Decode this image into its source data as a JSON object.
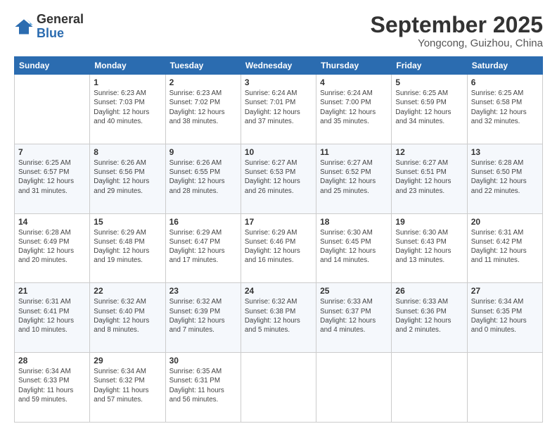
{
  "logo": {
    "general": "General",
    "blue": "Blue"
  },
  "header": {
    "month": "September 2025",
    "location": "Yongcong, Guizhou, China"
  },
  "days_of_week": [
    "Sunday",
    "Monday",
    "Tuesday",
    "Wednesday",
    "Thursday",
    "Friday",
    "Saturday"
  ],
  "weeks": [
    [
      {
        "day": "",
        "info": ""
      },
      {
        "day": "1",
        "info": "Sunrise: 6:23 AM\nSunset: 7:03 PM\nDaylight: 12 hours\nand 40 minutes."
      },
      {
        "day": "2",
        "info": "Sunrise: 6:23 AM\nSunset: 7:02 PM\nDaylight: 12 hours\nand 38 minutes."
      },
      {
        "day": "3",
        "info": "Sunrise: 6:24 AM\nSunset: 7:01 PM\nDaylight: 12 hours\nand 37 minutes."
      },
      {
        "day": "4",
        "info": "Sunrise: 6:24 AM\nSunset: 7:00 PM\nDaylight: 12 hours\nand 35 minutes."
      },
      {
        "day": "5",
        "info": "Sunrise: 6:25 AM\nSunset: 6:59 PM\nDaylight: 12 hours\nand 34 minutes."
      },
      {
        "day": "6",
        "info": "Sunrise: 6:25 AM\nSunset: 6:58 PM\nDaylight: 12 hours\nand 32 minutes."
      }
    ],
    [
      {
        "day": "7",
        "info": "Sunrise: 6:25 AM\nSunset: 6:57 PM\nDaylight: 12 hours\nand 31 minutes."
      },
      {
        "day": "8",
        "info": "Sunrise: 6:26 AM\nSunset: 6:56 PM\nDaylight: 12 hours\nand 29 minutes."
      },
      {
        "day": "9",
        "info": "Sunrise: 6:26 AM\nSunset: 6:55 PM\nDaylight: 12 hours\nand 28 minutes."
      },
      {
        "day": "10",
        "info": "Sunrise: 6:27 AM\nSunset: 6:53 PM\nDaylight: 12 hours\nand 26 minutes."
      },
      {
        "day": "11",
        "info": "Sunrise: 6:27 AM\nSunset: 6:52 PM\nDaylight: 12 hours\nand 25 minutes."
      },
      {
        "day": "12",
        "info": "Sunrise: 6:27 AM\nSunset: 6:51 PM\nDaylight: 12 hours\nand 23 minutes."
      },
      {
        "day": "13",
        "info": "Sunrise: 6:28 AM\nSunset: 6:50 PM\nDaylight: 12 hours\nand 22 minutes."
      }
    ],
    [
      {
        "day": "14",
        "info": "Sunrise: 6:28 AM\nSunset: 6:49 PM\nDaylight: 12 hours\nand 20 minutes."
      },
      {
        "day": "15",
        "info": "Sunrise: 6:29 AM\nSunset: 6:48 PM\nDaylight: 12 hours\nand 19 minutes."
      },
      {
        "day": "16",
        "info": "Sunrise: 6:29 AM\nSunset: 6:47 PM\nDaylight: 12 hours\nand 17 minutes."
      },
      {
        "day": "17",
        "info": "Sunrise: 6:29 AM\nSunset: 6:46 PM\nDaylight: 12 hours\nand 16 minutes."
      },
      {
        "day": "18",
        "info": "Sunrise: 6:30 AM\nSunset: 6:45 PM\nDaylight: 12 hours\nand 14 minutes."
      },
      {
        "day": "19",
        "info": "Sunrise: 6:30 AM\nSunset: 6:43 PM\nDaylight: 12 hours\nand 13 minutes."
      },
      {
        "day": "20",
        "info": "Sunrise: 6:31 AM\nSunset: 6:42 PM\nDaylight: 12 hours\nand 11 minutes."
      }
    ],
    [
      {
        "day": "21",
        "info": "Sunrise: 6:31 AM\nSunset: 6:41 PM\nDaylight: 12 hours\nand 10 minutes."
      },
      {
        "day": "22",
        "info": "Sunrise: 6:32 AM\nSunset: 6:40 PM\nDaylight: 12 hours\nand 8 minutes."
      },
      {
        "day": "23",
        "info": "Sunrise: 6:32 AM\nSunset: 6:39 PM\nDaylight: 12 hours\nand 7 minutes."
      },
      {
        "day": "24",
        "info": "Sunrise: 6:32 AM\nSunset: 6:38 PM\nDaylight: 12 hours\nand 5 minutes."
      },
      {
        "day": "25",
        "info": "Sunrise: 6:33 AM\nSunset: 6:37 PM\nDaylight: 12 hours\nand 4 minutes."
      },
      {
        "day": "26",
        "info": "Sunrise: 6:33 AM\nSunset: 6:36 PM\nDaylight: 12 hours\nand 2 minutes."
      },
      {
        "day": "27",
        "info": "Sunrise: 6:34 AM\nSunset: 6:35 PM\nDaylight: 12 hours\nand 0 minutes."
      }
    ],
    [
      {
        "day": "28",
        "info": "Sunrise: 6:34 AM\nSunset: 6:33 PM\nDaylight: 11 hours\nand 59 minutes."
      },
      {
        "day": "29",
        "info": "Sunrise: 6:34 AM\nSunset: 6:32 PM\nDaylight: 11 hours\nand 57 minutes."
      },
      {
        "day": "30",
        "info": "Sunrise: 6:35 AM\nSunset: 6:31 PM\nDaylight: 11 hours\nand 56 minutes."
      },
      {
        "day": "",
        "info": ""
      },
      {
        "day": "",
        "info": ""
      },
      {
        "day": "",
        "info": ""
      },
      {
        "day": "",
        "info": ""
      }
    ]
  ]
}
